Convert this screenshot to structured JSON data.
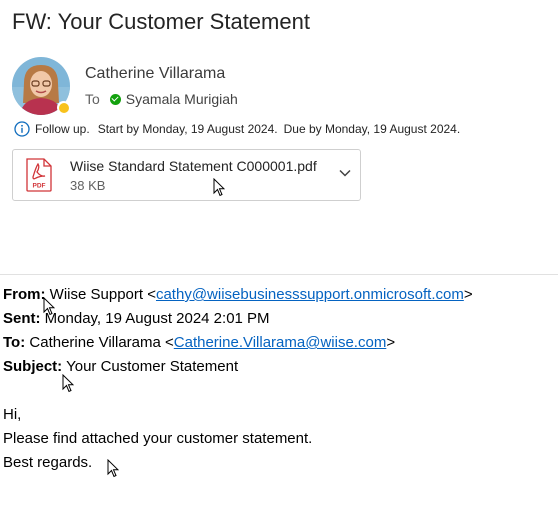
{
  "header": {
    "subject": "FW: Your Customer Statement",
    "sender_name": "Catherine Villarama",
    "to_label": "To",
    "recipient": "Syamala Murigiah",
    "followup_label": "Follow up.",
    "followup_start": "Start by Monday, 19 August 2024.",
    "followup_due": "Due by Monday, 19 August 2024."
  },
  "attachment": {
    "filename": "Wiise Standard Statement C000001.pdf",
    "size": "38 KB",
    "icon_text": "PDF"
  },
  "forwarded": {
    "from_label": "From:",
    "from_name": "Wiise Support <",
    "from_email": "cathy@wiisebusinesssupport.onmicrosoft.com",
    "from_close": ">",
    "sent_label": "Sent:",
    "sent_value": "Monday, 19 August 2024 2:01 PM",
    "to_label": "To:",
    "to_name": "Catherine Villarama <",
    "to_email": "Catherine.Villarama@wiise.com",
    "to_close": ">",
    "subject_label": "Subject:",
    "subject_value": "Your Customer Statement"
  },
  "message": {
    "greeting": "Hi,",
    "line1": "Please find attached your customer statement.",
    "signoff": "Best regards."
  },
  "colors": {
    "link": "#0563c1",
    "pdf_red": "#d13438",
    "presence_away": "#f8c21c",
    "status_available": "#13a10e",
    "info_blue": "#0f6cbd"
  }
}
